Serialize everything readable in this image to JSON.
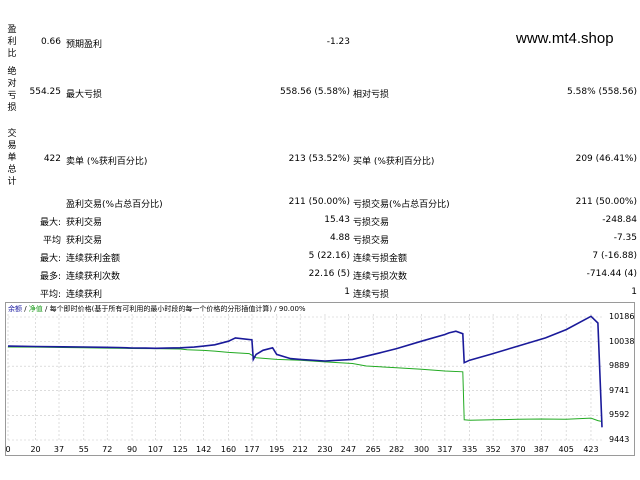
{
  "watermark": "www.mt4.shop",
  "side_labels": {
    "profit_factor": "盈利比",
    "absolute_drawdown": "绝对亏损",
    "total_trades": "交易单总计"
  },
  "row1": {
    "value": "0.66",
    "label": "预期盈利",
    "value2": "-1.23"
  },
  "row2": {
    "value": "554.25",
    "label": "最大亏损",
    "value2": "558.56 (5.58%)",
    "label3": "相对亏损",
    "value3": "5.58% (558.56)"
  },
  "row3": {
    "value": "422",
    "label": "卖单 (%获利百分比)",
    "value2": "213 (53.52%)",
    "label3": "买单 (%获利百分比)",
    "value3": "209 (46.41%)"
  },
  "row4": {
    "label": "盈利交易(%占总百分比)",
    "value2": "211 (50.00%)",
    "label3": "亏损交易(%占总百分比)",
    "value3": "211 (50.00%)"
  },
  "row5": {
    "prefix": "最大:",
    "label": "获利交易",
    "value2": "15.43",
    "label3": "亏损交易",
    "value3": "-248.84"
  },
  "row6": {
    "prefix": "平均",
    "label": "获利交易",
    "value2": "4.88",
    "label3": "亏损交易",
    "value3": "-7.35"
  },
  "row7": {
    "prefix": "最大:",
    "label": "连续获利金额",
    "value2": "5 (22.16)",
    "label3": "连续亏损金额",
    "value3": "7 (-16.88)"
  },
  "row8": {
    "prefix": "最多:",
    "label": "连续获利次数",
    "value2": "22.16 (5)",
    "label3": "连续亏损次数",
    "value3": "-714.44 (4)"
  },
  "row9": {
    "prefix": "平均:",
    "label": "连续获利",
    "value2": "1",
    "label3": "连续亏损",
    "value3": "1"
  },
  "chart_legend": {
    "balance": "余额",
    "sep1": " / ",
    "equity": "净值",
    "rest": " / 每个即时价格(基于所有可利用的最小时段的每一个价格的分形插值计算) / 90.00%"
  },
  "colors": {
    "balance": "#1a1a9a",
    "equity": "#22aa22",
    "grid": "#c8c8c8"
  },
  "chart_data": {
    "type": "line",
    "x_ticks": [
      0,
      20,
      37,
      55,
      72,
      90,
      107,
      125,
      142,
      160,
      177,
      195,
      212,
      230,
      247,
      265,
      282,
      300,
      317,
      335,
      352,
      370,
      387,
      405,
      423
    ],
    "y_ticks": [
      10186,
      10038,
      9889,
      9741,
      9592,
      9443
    ],
    "ylim": [
      9443,
      10186
    ],
    "xlim": [
      0,
      431
    ],
    "series": [
      {
        "x": [
          0,
          20,
          40,
          55,
          70,
          80,
          90,
          100,
          107,
          115,
          125,
          135,
          142,
          150,
          160,
          165,
          177,
          178,
          180,
          185,
          192,
          195,
          205,
          212,
          230,
          250,
          270,
          282,
          300,
          317,
          320,
          325,
          330,
          331,
          335,
          350,
          370,
          390,
          405,
          423,
          428,
          431
        ],
        "y": [
          10010,
          10008,
          10006,
          10005,
          10003,
          10002,
          9999,
          9998,
          9997,
          9998,
          10000,
          10004,
          10010,
          10018,
          10040,
          10060,
          10048,
          9930,
          9960,
          9985,
          10000,
          9960,
          9935,
          9930,
          9920,
          9930,
          9970,
          9995,
          10040,
          10080,
          10090,
          10100,
          10085,
          9910,
          9925,
          9960,
          10010,
          10060,
          10110,
          10190,
          10150,
          9520
        ]
      },
      {
        "x": [
          0,
          20,
          40,
          55,
          72,
          90,
          107,
          125,
          130,
          142,
          150,
          160,
          175,
          180,
          195,
          212,
          230,
          250,
          260,
          282,
          300,
          317,
          330,
          331,
          335,
          352,
          370,
          387,
          405,
          423,
          428,
          431
        ],
        "y": [
          10005,
          10004,
          10002,
          10000,
          9998,
          9996,
          9995,
          9993,
          9988,
          9984,
          9980,
          9972,
          9965,
          9940,
          9930,
          9925,
          9915,
          9905,
          9890,
          9880,
          9870,
          9860,
          9855,
          9565,
          9562,
          9565,
          9568,
          9570,
          9568,
          9575,
          9560,
          9555
        ]
      }
    ]
  }
}
